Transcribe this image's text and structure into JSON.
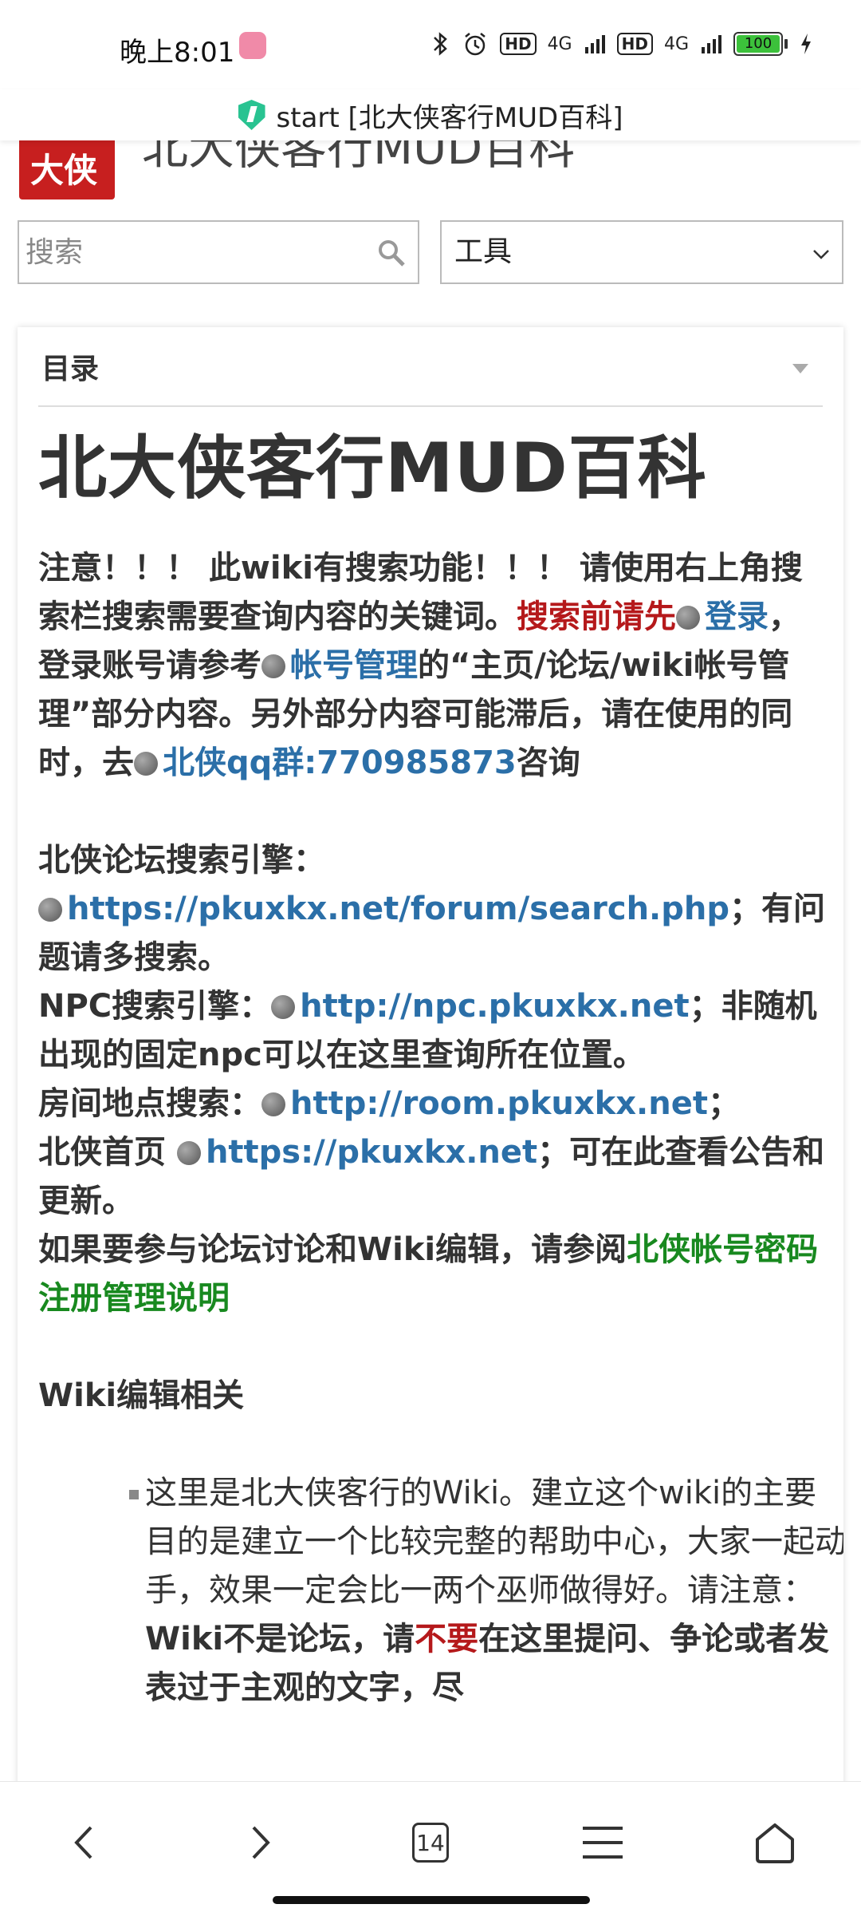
{
  "status_bar": {
    "time": "晚上8:01",
    "network_labels": [
      "HD",
      "4G",
      "HD",
      "4G"
    ],
    "battery": "100",
    "battery_level": 1.0
  },
  "title_bar": {
    "title": "start [北大侠客行MUD百科]"
  },
  "site": {
    "logo_text": "大侠",
    "title": "北大侠客行MUD百科"
  },
  "search": {
    "placeholder": "搜索"
  },
  "tools": {
    "label": "工具"
  },
  "toc": {
    "label": "目录"
  },
  "page": {
    "heading": "北大侠客行MUD百科",
    "notice": "注意！！！ 此wiki有搜索功能！！！ 请使用右上角搜索栏搜索需要查询内容的关键词。",
    "notice_red": "搜索前请先",
    "login_link": "登录",
    "login_text": "，登录账号请参考",
    "account_link": "帐号管理",
    "account_text": "的“主页/论坛/wiki帐号管理”部分内容。另外部分内容可能滞后，请在使用的同时，去",
    "qq_link": "北侠qq群:770985873",
    "qq_text": "咨询",
    "forum_search_label": "北侠论坛搜索引擎：",
    "forum_search_link": "https://pkuxkx.net/forum/search.php",
    "forum_search_text": "；有问题请多搜索。",
    "npc_label": "NPC搜索引擎：",
    "npc_link": "http://npc.pkuxkx.net",
    "npc_text": "；非随机出现的固定npc可以在这里查询所在位置。",
    "room_label": "房间地点搜索：",
    "room_link": "http://room.pkuxkx.net",
    "room_text": "；",
    "home_label": "北侠首页",
    "home_link": "https://pkuxkx.net",
    "home_text": "；可在此查看公告和更新。",
    "wiki_ref_text": "如果要参与论坛讨论和Wiki编辑，请参阅",
    "wiki_ref_link": "北侠帐号密码注册管理说明",
    "edit_heading": "Wiki编辑相关",
    "bullet_1a": "这里是北大侠客行的Wiki。建立这个wiki的主要目的是建立一个比较完整的帮助中心，大家一起动手，效果一定会比一两个巫师做得好。请注意：",
    "bullet_1b": "Wiki不是论坛，请",
    "bullet_1c": "不要",
    "bullet_1d": "在这里提问、争论或者发表过于主观的文字，尽"
  },
  "nav_bar": {
    "tab_count": "14"
  },
  "colors": {
    "link_blue": "#2b6fa8",
    "warning_red": "#b5191b",
    "link_green": "#18891f",
    "shield_green": "#29c391",
    "logo_red": "#c71f1f"
  },
  "icons": [
    "bluetooth-icon",
    "alarm-icon",
    "signal-icon",
    "battery-icon",
    "charging-icon",
    "shield-icon",
    "search-icon",
    "chevron-down-icon",
    "globe-icon",
    "back-icon",
    "forward-icon",
    "tabs-icon",
    "menu-icon",
    "home-icon"
  ]
}
